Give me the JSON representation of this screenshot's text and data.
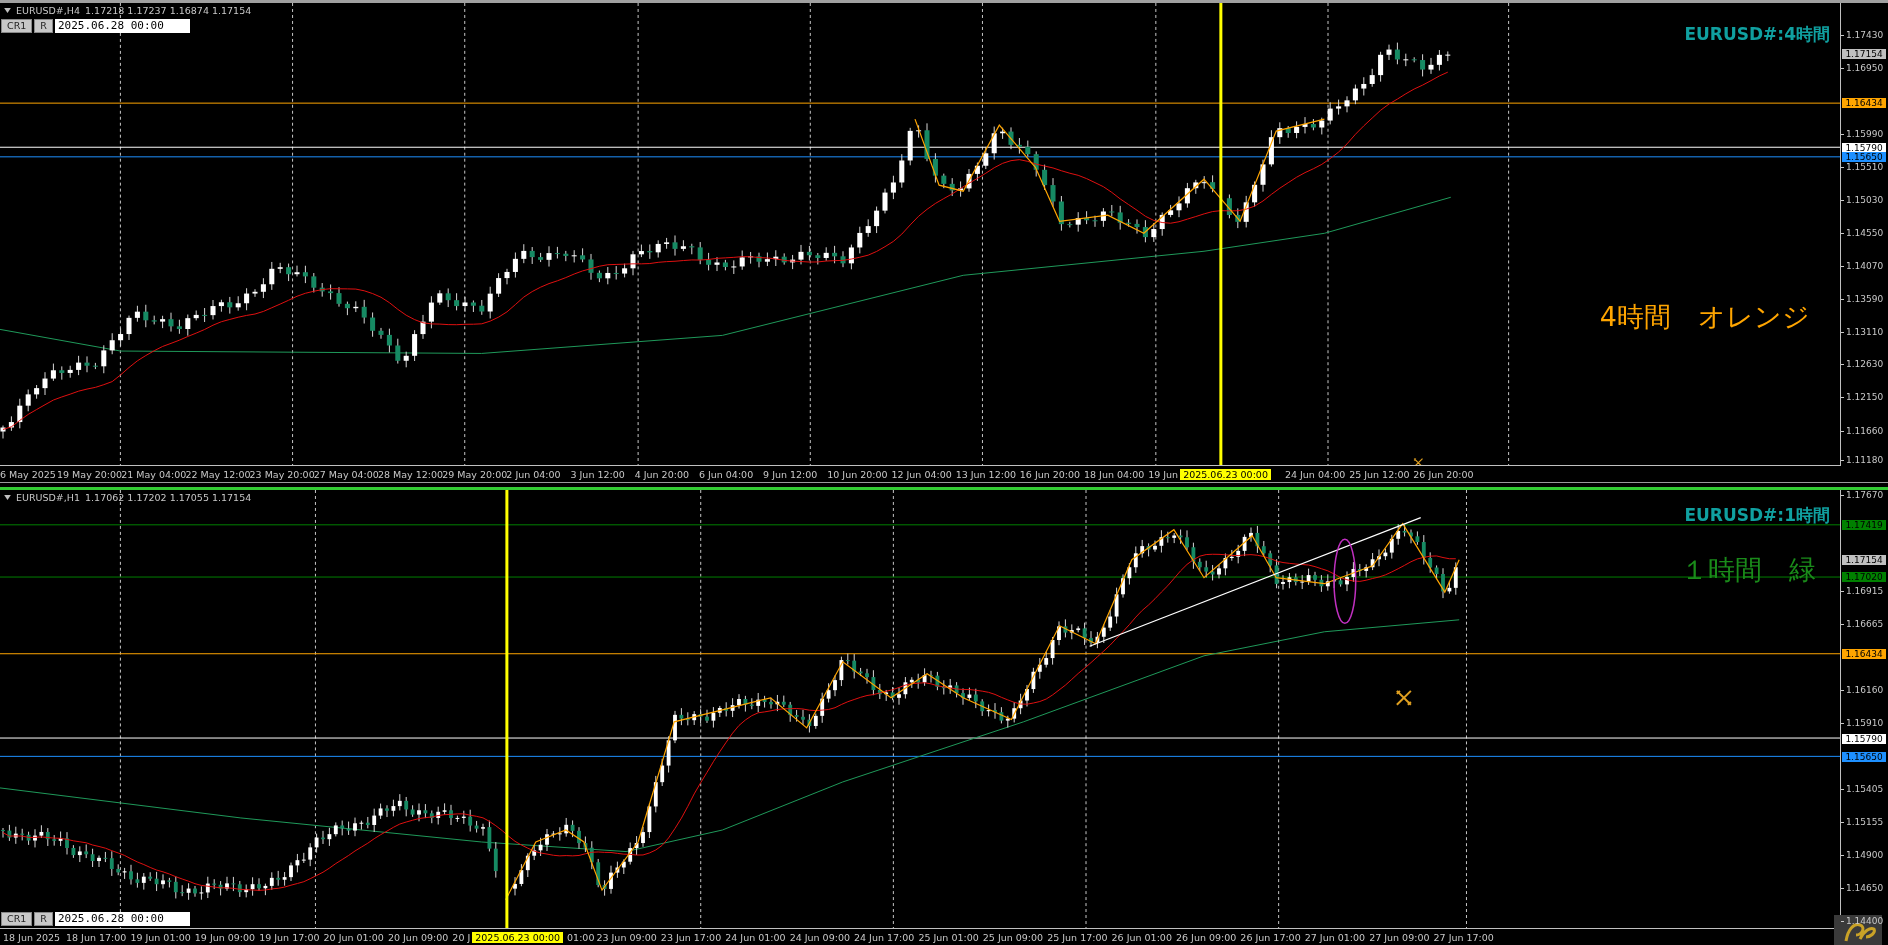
{
  "charts": [
    {
      "active": false,
      "symbol": "EURUSD#,H4",
      "ohlc": "1.17218 1.17237 1.16874 1.17154",
      "toolbar": {
        "buttons": [
          "CR1",
          "R"
        ],
        "date": "2025.06.28 00:00"
      },
      "title": "EURUSD#:4時間",
      "note": {
        "text": "4時間　オレンジ",
        "color": "#ffa500"
      },
      "price_ticks": [
        "1.17430",
        "1.16950",
        "1.15990",
        "1.15510",
        "1.15030",
        "1.14550",
        "1.14070",
        "1.13590",
        "1.13110",
        "1.12630",
        "1.12150",
        "1.11660",
        "1.11180"
      ],
      "price_levels": [
        {
          "price": "1.17154",
          "color": "#c0c0c0",
          "kind": "bid"
        },
        {
          "price": "1.16434",
          "color": "#ffa500",
          "kind": "line"
        },
        {
          "price": "1.15790",
          "color": "#ffffff",
          "kind": "line"
        },
        {
          "price": "1.15650",
          "color": "#1e90ff",
          "kind": "line"
        }
      ],
      "time_labels": [
        {
          "text": "6 May 2025",
          "kind": "first"
        },
        {
          "text": "19 May 20:00",
          "kind": "tick"
        },
        {
          "text": "21 May 04:00",
          "kind": "tick"
        },
        {
          "text": "22 May 12:00",
          "kind": "tick"
        },
        {
          "text": "23 May 20:00",
          "kind": "tick"
        },
        {
          "text": "27 May 04:00",
          "kind": "tick"
        },
        {
          "text": "28 May 12:00",
          "kind": "tick"
        },
        {
          "text": "29 May 20:00",
          "kind": "tick"
        },
        {
          "text": "2 Jun 04:00",
          "kind": "tick"
        },
        {
          "text": "3 Jun 12:00",
          "kind": "tick"
        },
        {
          "text": "4 Jun 20:00",
          "kind": "tick"
        },
        {
          "text": "6 Jun 04:00",
          "kind": "tick"
        },
        {
          "text": "9 Jun 12:00",
          "kind": "tick"
        },
        {
          "text": "10 Jun 20:00",
          "kind": "tick"
        },
        {
          "text": "12 Jun 04:00",
          "kind": "tick"
        },
        {
          "text": "13 Jun 12:00",
          "kind": "tick"
        },
        {
          "text": "16 Jun 20:00",
          "kind": "tick"
        },
        {
          "text": "18 Jun 04:00",
          "kind": "tick"
        },
        {
          "text": "19 Jun",
          "kind": "partial"
        },
        {
          "text": "2025.06.23 00:00",
          "kind": "cursor"
        },
        {
          "text": "24 Jun 04:00",
          "kind": "tick"
        },
        {
          "text": "25 Jun 12:00",
          "kind": "tick"
        },
        {
          "text": "26 Jun 20:00",
          "kind": "tick"
        }
      ]
    },
    {
      "active": true,
      "symbol": "EURUSD#,H1",
      "ohlc": "1.17062 1.17202 1.17055 1.17154",
      "toolbar": {
        "buttons": [
          "CR1",
          "R"
        ],
        "date": "2025.06.28 00:00"
      },
      "title": "EURUSD#:1時間",
      "note": {
        "text": "１時間　緑",
        "color": "#1a8c1a"
      },
      "price_ticks": [
        "1.17670",
        "1.16915",
        "1.16665",
        "1.16160",
        "1.15910",
        "1.15405",
        "1.15155",
        "1.14900",
        "1.14650",
        "1.14400"
      ],
      "price_levels": [
        {
          "price": "1.17419",
          "color": "#008000",
          "kind": "line"
        },
        {
          "price": "1.17154",
          "color": "#c0c0c0",
          "kind": "bid"
        },
        {
          "price": "1.17020",
          "color": "#008000",
          "kind": "line"
        },
        {
          "price": "1.16434",
          "color": "#ffa500",
          "kind": "line"
        },
        {
          "price": "1.15790",
          "color": "#ffffff",
          "kind": "line"
        },
        {
          "price": "1.15650",
          "color": "#1e90ff",
          "kind": "line"
        }
      ],
      "time_labels": [
        {
          "text": "18 Jun 2025",
          "kind": "first"
        },
        {
          "text": "18 Jun 17:00",
          "kind": "tick"
        },
        {
          "text": "19 Jun 01:00",
          "kind": "tick"
        },
        {
          "text": "19 Jun 09:00",
          "kind": "tick"
        },
        {
          "text": "19 Jun 17:00",
          "kind": "tick"
        },
        {
          "text": "20 Jun 01:00",
          "kind": "tick"
        },
        {
          "text": "20 Jun 09:00",
          "kind": "tick"
        },
        {
          "text": "20 J",
          "kind": "partial"
        },
        {
          "text": "2025.06.23 00:00",
          "kind": "cursor"
        },
        {
          "text": "01:00",
          "kind": "partial"
        },
        {
          "text": "23 Jun 09:00",
          "kind": "tick"
        },
        {
          "text": "23 Jun 17:00",
          "kind": "tick"
        },
        {
          "text": "24 Jun 01:00",
          "kind": "tick"
        },
        {
          "text": "24 Jun 09:00",
          "kind": "tick"
        },
        {
          "text": "24 Jun 17:00",
          "kind": "tick"
        },
        {
          "text": "25 Jun 01:00",
          "kind": "tick"
        },
        {
          "text": "25 Jun 09:00",
          "kind": "tick"
        },
        {
          "text": "25 Jun 17:00",
          "kind": "tick"
        },
        {
          "text": "26 Jun 01:00",
          "kind": "tick"
        },
        {
          "text": "26 Jun 09:00",
          "kind": "tick"
        },
        {
          "text": "26 Jun 17:00",
          "kind": "tick"
        },
        {
          "text": "27 Jun 01:00",
          "kind": "tick"
        },
        {
          "text": "27 Jun 09:00",
          "kind": "tick"
        },
        {
          "text": "27 Jun 17:00",
          "kind": "tick"
        }
      ]
    }
  ]
}
